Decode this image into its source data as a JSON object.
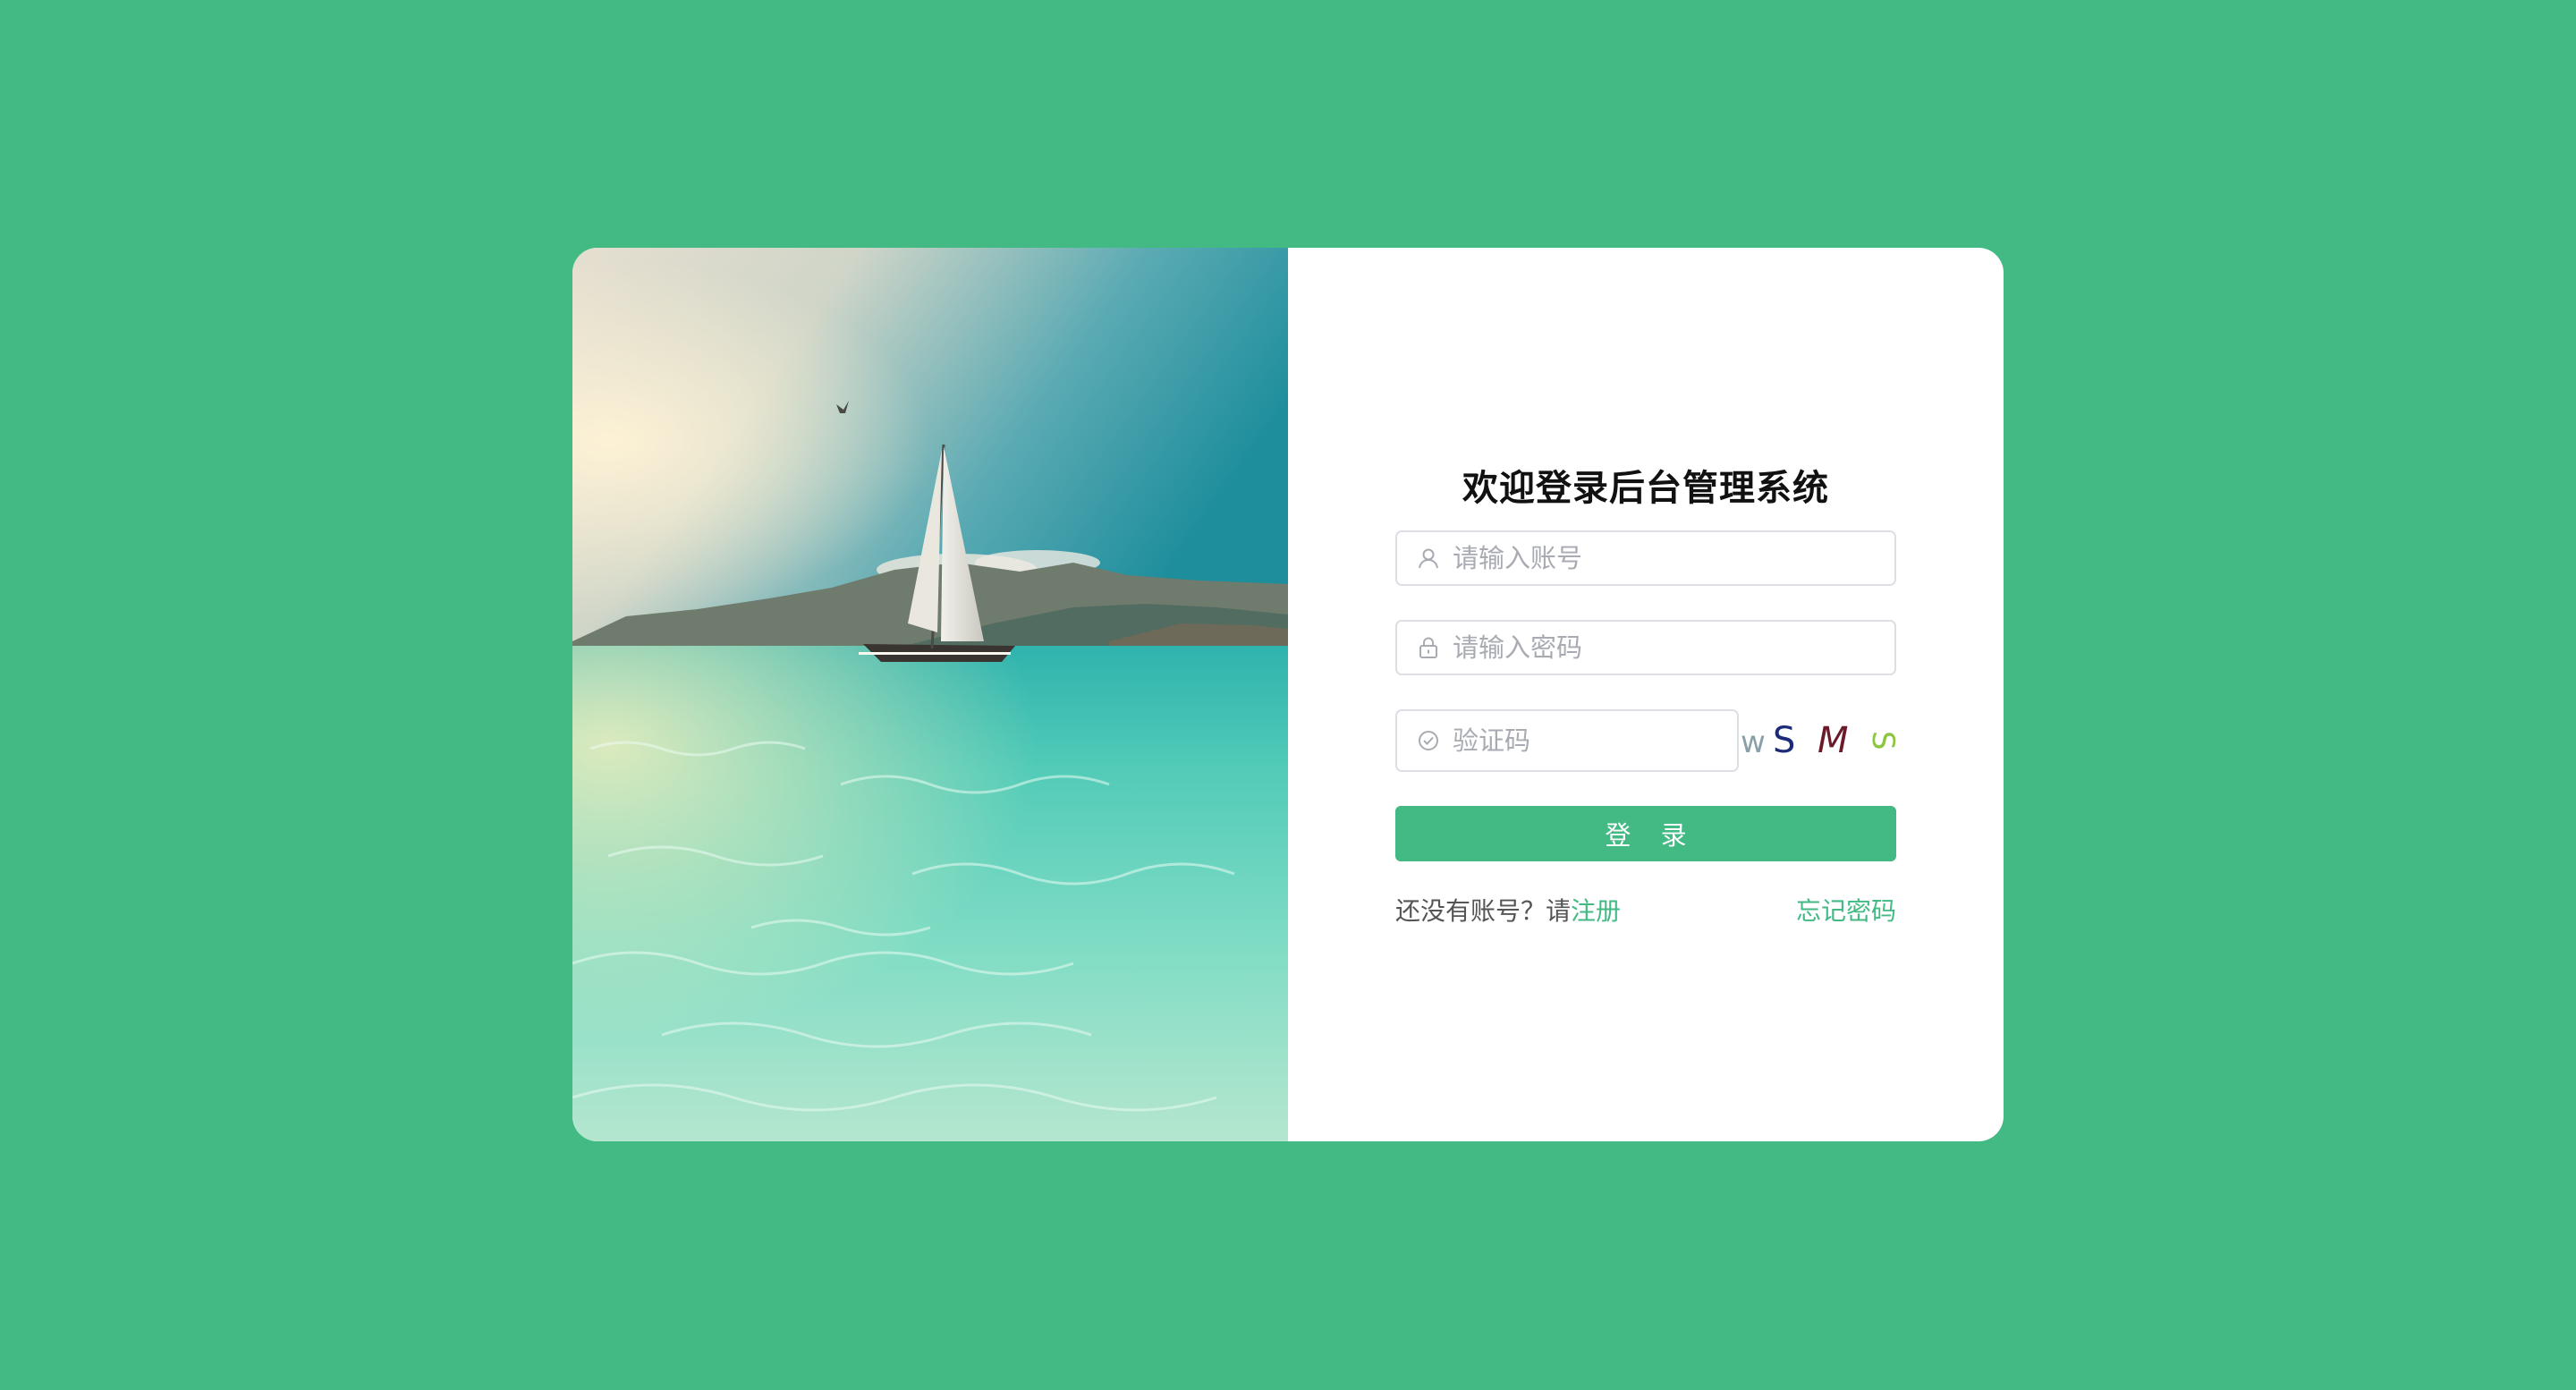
{
  "page": {
    "title": "欢迎登录后台管理系统",
    "background_color": "#43ba84",
    "accent_color": "#43ba84"
  },
  "form": {
    "username": {
      "placeholder": "请输入账号",
      "value": "",
      "icon": "user-icon"
    },
    "password": {
      "placeholder": "请输入密码",
      "value": "",
      "icon": "lock-icon"
    },
    "captcha": {
      "placeholder": "验证码",
      "value": "",
      "icon": "check-circle-icon",
      "image_text": [
        "w",
        "S",
        "M",
        "S"
      ]
    },
    "login_label": "登 录"
  },
  "footer": {
    "no_account_text": "还没有账号？请",
    "register_label": "注册",
    "forgot_label": "忘记密码"
  },
  "illustration": {
    "scene": "sailboat on turquoise sea"
  }
}
